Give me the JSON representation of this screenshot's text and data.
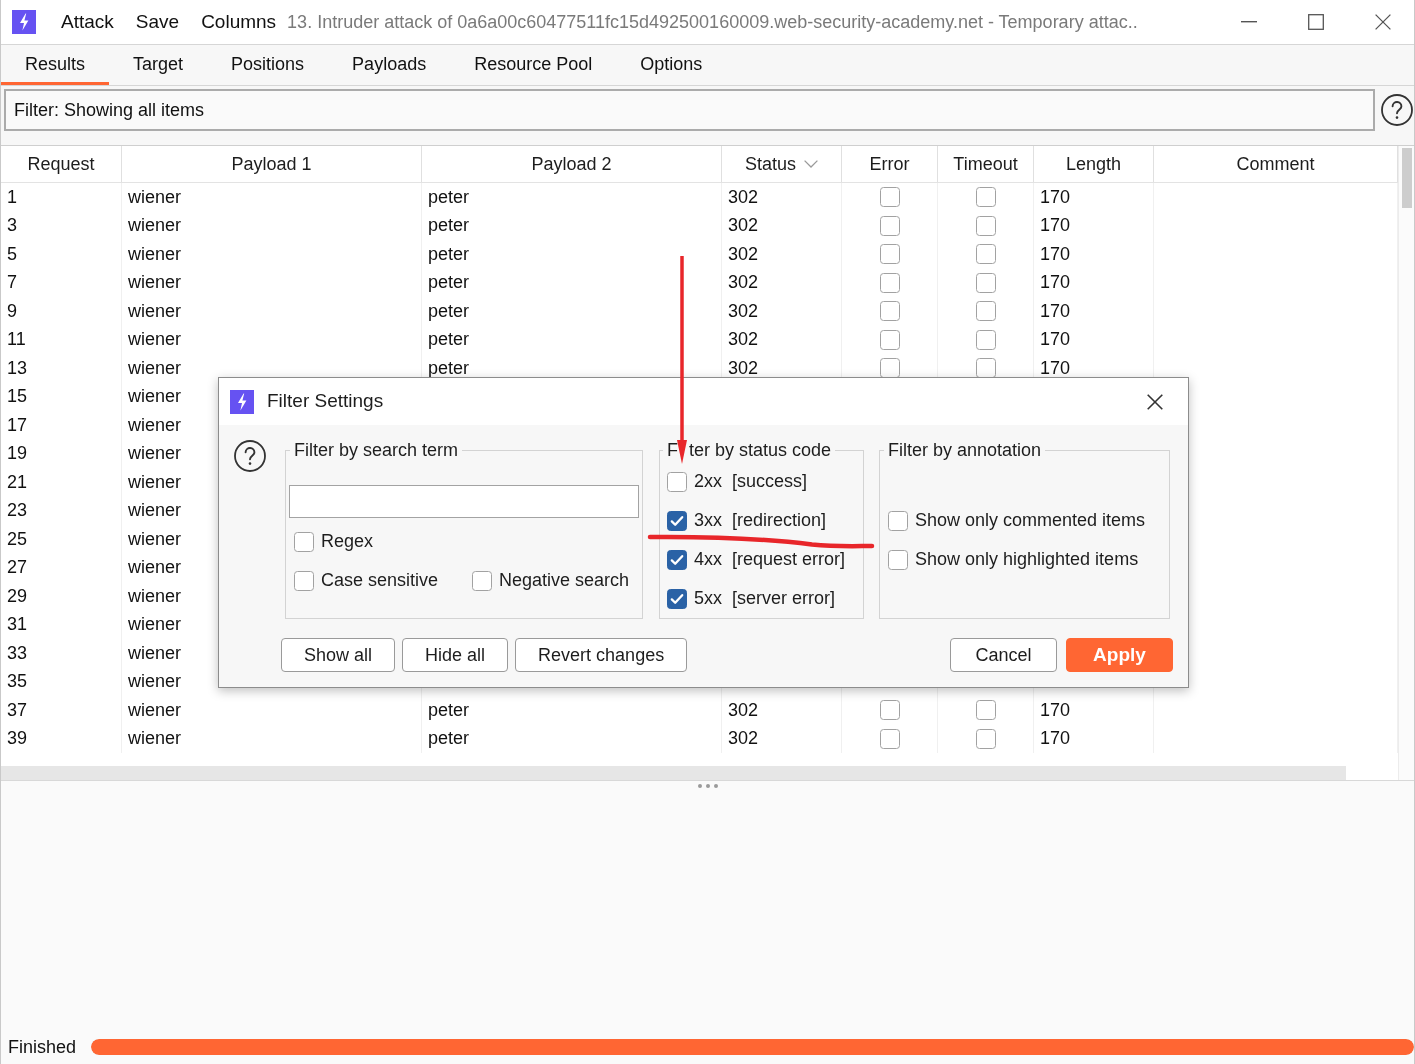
{
  "window": {
    "menu": [
      "Attack",
      "Save",
      "Columns"
    ],
    "title": "13. Intruder attack of 0a6a00c60477511fc15d492500160009.web-security-academy.net - Temporary attac.."
  },
  "tabs": [
    {
      "label": "Results",
      "selected": true
    },
    {
      "label": "Target",
      "selected": false
    },
    {
      "label": "Positions",
      "selected": false
    },
    {
      "label": "Payloads",
      "selected": false
    },
    {
      "label": "Resource Pool",
      "selected": false
    },
    {
      "label": "Options",
      "selected": false
    }
  ],
  "filter_bar": {
    "text": "Filter: Showing all items"
  },
  "table": {
    "columns": [
      {
        "label": "Request",
        "sorted": false
      },
      {
        "label": "Payload 1",
        "sorted": false
      },
      {
        "label": "Payload 2",
        "sorted": false
      },
      {
        "label": "Status",
        "sorted": true
      },
      {
        "label": "Error",
        "sorted": false
      },
      {
        "label": "Timeout",
        "sorted": false
      },
      {
        "label": "Length",
        "sorted": false
      },
      {
        "label": "Comment",
        "sorted": false
      }
    ],
    "rows": [
      {
        "request": "1",
        "payload_1": "wiener",
        "payload_2": "peter",
        "status": "302",
        "error": false,
        "timeout": false,
        "length": "170"
      },
      {
        "request": "3",
        "payload_1": "wiener",
        "payload_2": "peter",
        "status": "302",
        "error": false,
        "timeout": false,
        "length": "170"
      },
      {
        "request": "5",
        "payload_1": "wiener",
        "payload_2": "peter",
        "status": "302",
        "error": false,
        "timeout": false,
        "length": "170"
      },
      {
        "request": "7",
        "payload_1": "wiener",
        "payload_2": "peter",
        "status": "302",
        "error": false,
        "timeout": false,
        "length": "170"
      },
      {
        "request": "9",
        "payload_1": "wiener",
        "payload_2": "peter",
        "status": "302",
        "error": false,
        "timeout": false,
        "length": "170"
      },
      {
        "request": "11",
        "payload_1": "wiener",
        "payload_2": "peter",
        "status": "302",
        "error": false,
        "timeout": false,
        "length": "170"
      },
      {
        "request": "13",
        "payload_1": "wiener",
        "payload_2": "peter",
        "status": "302",
        "error": false,
        "timeout": false,
        "length": "170"
      },
      {
        "request": "15",
        "payload_1": "wiener"
      },
      {
        "request": "17",
        "payload_1": "wiener"
      },
      {
        "request": "19",
        "payload_1": "wiener"
      },
      {
        "request": "21",
        "payload_1": "wiener"
      },
      {
        "request": "23",
        "payload_1": "wiener"
      },
      {
        "request": "25",
        "payload_1": "wiener"
      },
      {
        "request": "27",
        "payload_1": "wiener"
      },
      {
        "request": "29",
        "payload_1": "wiener"
      },
      {
        "request": "31",
        "payload_1": "wiener"
      },
      {
        "request": "33",
        "payload_1": "wiener"
      },
      {
        "request": "35",
        "payload_1": "wiener"
      },
      {
        "request": "37",
        "payload_1": "wiener",
        "payload_2": "peter",
        "status": "302",
        "error": false,
        "timeout": false,
        "length": "170"
      },
      {
        "request": "39",
        "payload_1": "wiener",
        "payload_2": "peter",
        "status": "302",
        "error": false,
        "timeout": false,
        "length": "170"
      }
    ]
  },
  "dialog": {
    "title": "Filter Settings",
    "search_group": {
      "legend": "Filter by search term",
      "options": [
        {
          "label": "Regex",
          "checked": false
        },
        {
          "label": "Case sensitive",
          "checked": false
        },
        {
          "label": "Negative search",
          "checked": false
        }
      ]
    },
    "status_group": {
      "legend_parts": [
        "F",
        "ter by status code"
      ],
      "options": [
        {
          "code": "2xx",
          "label": "[success]",
          "checked": false
        },
        {
          "code": "3xx",
          "label": "[redirection]",
          "checked": true
        },
        {
          "code": "4xx",
          "label": "[request error]",
          "checked": true
        },
        {
          "code": "5xx",
          "label": "[server error]",
          "checked": true
        }
      ]
    },
    "annotation_group": {
      "legend": "Filter by annotation",
      "options": [
        {
          "label": "Show only commented items",
          "checked": false
        },
        {
          "label": "Show only highlighted items",
          "checked": false
        }
      ]
    },
    "left_buttons": [
      {
        "label": "Show all"
      },
      {
        "label": "Hide all"
      },
      {
        "label": "Revert changes"
      }
    ],
    "right_buttons": [
      {
        "label": "Cancel",
        "kind": "default"
      },
      {
        "label": "Apply",
        "kind": "primary"
      }
    ]
  },
  "status_bar": {
    "text": "Finished",
    "progress": {
      "level": 1
    }
  }
}
